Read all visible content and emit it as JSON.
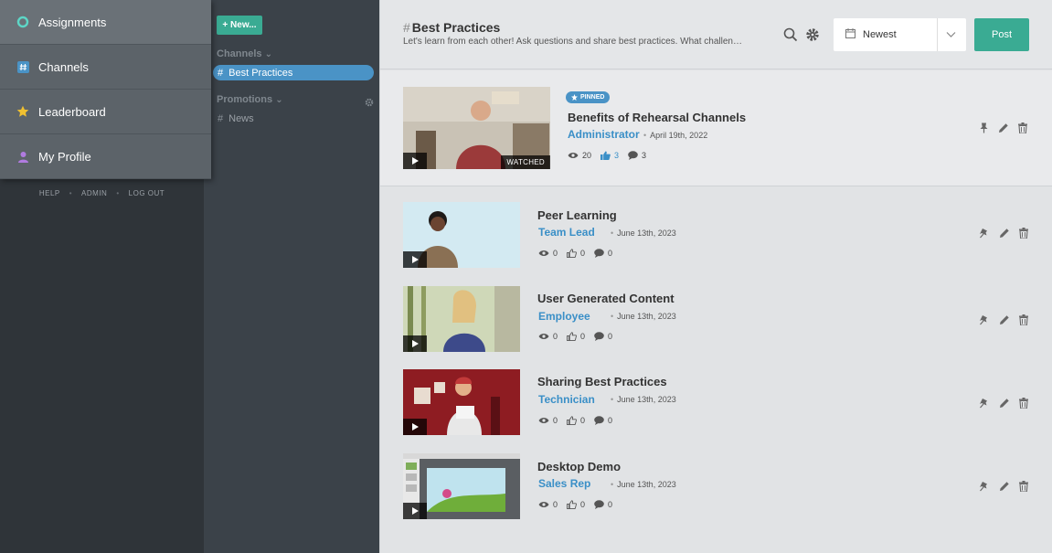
{
  "nav": {
    "items": [
      {
        "label": "Assignments",
        "icon": "ring-icon",
        "color": "#5dd6c6"
      },
      {
        "label": "Channels",
        "icon": "hash-box-icon",
        "color": "#4a93c6"
      },
      {
        "label": "Leaderboard",
        "icon": "star-icon",
        "color": "#f0c030"
      },
      {
        "label": "My Profile",
        "icon": "person-icon",
        "color": "#b07be0"
      }
    ],
    "footer": {
      "help": "HELP",
      "admin": "ADMIN",
      "logout": "LOG OUT",
      "sep": "•"
    }
  },
  "channels": {
    "new_label": "+ New...",
    "channels_header": "Channels",
    "channel_items": [
      {
        "label": "Best Practices",
        "active": true
      }
    ],
    "promotions_header": "Promotions",
    "promotion_items": [
      {
        "label": "News"
      }
    ],
    "hash": "#",
    "chevron": "⌄"
  },
  "header": {
    "hash": "#",
    "title": "Best Practices",
    "description": "Let's learn from each other! Ask questions and share best practices. What challen…",
    "sort_label": "Newest",
    "post_label": "Post"
  },
  "pinned": {
    "badge": "PINNED",
    "title": "Benefits of Rehearsal Channels",
    "author": "Administrator",
    "date": "April 19th, 2022",
    "views": "20",
    "likes": "3",
    "comments": "3",
    "watched": "WATCHED"
  },
  "posts": [
    {
      "title": "Peer Learning",
      "author": "Team Lead",
      "date": "June 13th, 2023",
      "views": "0",
      "likes": "0",
      "comments": "0"
    },
    {
      "title": "User Generated Content",
      "author": "Employee",
      "date": "June 13th, 2023",
      "views": "0",
      "likes": "0",
      "comments": "0"
    },
    {
      "title": "Sharing Best Practices",
      "author": "Technician",
      "date": "June 13th, 2023",
      "views": "0",
      "likes": "0",
      "comments": "0"
    },
    {
      "title": "Desktop Demo",
      "author": "Sales Rep",
      "date": "June 13th, 2023",
      "views": "0",
      "likes": "0",
      "comments": "0"
    }
  ],
  "colors": {
    "accent": "#3aab93",
    "link": "#3a8fc7",
    "active_channel": "#4a93c6"
  }
}
